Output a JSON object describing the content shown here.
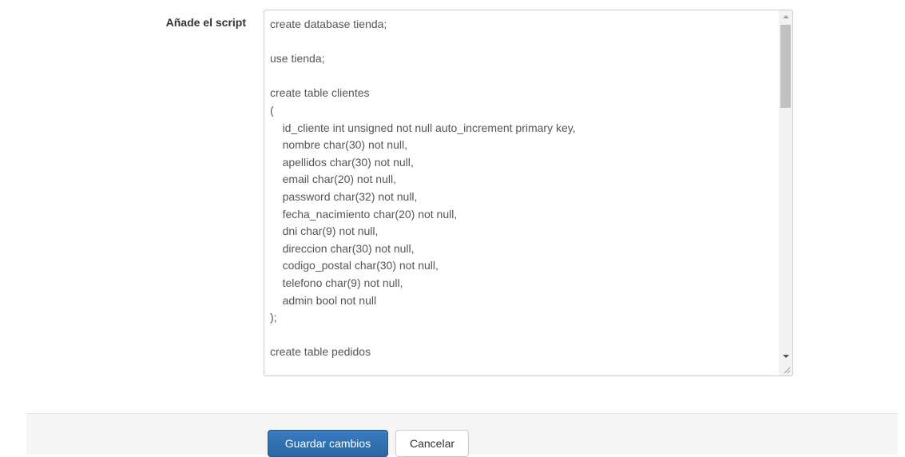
{
  "form": {
    "script_label": "Añade el script",
    "script_value": "create database tienda;\n\nuse tienda;\n\ncreate table clientes\n(\n\tid_cliente int unsigned not null auto_increment primary key,\n\tnombre char(30) not null,\n\tapellidos char(30) not null,\n\temail char(20) not null,\n\tpassword char(32) not null,\n\tfecha_nacimiento char(20) not null,\n\tdni char(9) not null,\n\tdireccion char(30) not null,\n\tcodigo_postal char(30) not null,\n\ttelefono char(9) not null,\n\tadmin bool not null\n);\n\ncreate table pedidos"
  },
  "actions": {
    "save_label": "Guardar cambios",
    "cancel_label": "Cancelar"
  },
  "colors": {
    "primary": "#2e6da4",
    "footer_bg": "#f5f5f5"
  }
}
